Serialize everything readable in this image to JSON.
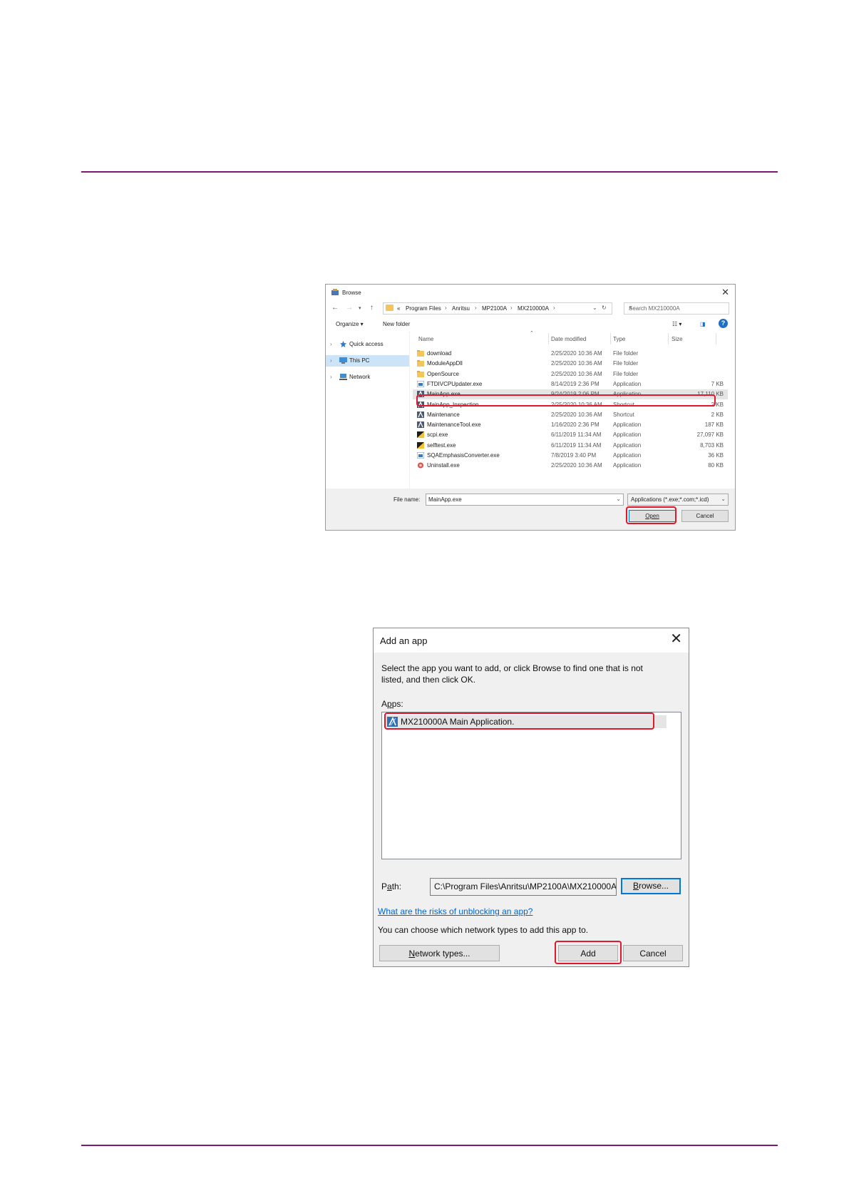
{
  "browse_dialog": {
    "title": "Browse",
    "close_glyph": "✕",
    "address_crumbs": [
      "«",
      "Program Files",
      "Anritsu",
      "MP2100A",
      "MX210000A"
    ],
    "search_placeholder": "Search MX210000A",
    "organize_label": "Organize ▾",
    "new_folder_label": "New folder",
    "help_glyph": "?",
    "nav_items": [
      {
        "label": "Quick access",
        "icon": "star-icon"
      },
      {
        "label": "This PC",
        "icon": "computer-icon",
        "selected": true
      },
      {
        "label": "Network",
        "icon": "network-icon"
      }
    ],
    "columns": [
      "Name",
      "Date modified",
      "Type",
      "Size"
    ],
    "files": [
      {
        "name": "download",
        "date": "2/25/2020 10:36 AM",
        "type": "File folder",
        "size": "",
        "icon": "folder-icon"
      },
      {
        "name": "ModuleAppDll",
        "date": "2/25/2020 10:36 AM",
        "type": "File folder",
        "size": "",
        "icon": "folder-icon"
      },
      {
        "name": "OpenSource",
        "date": "2/25/2020 10:36 AM",
        "type": "File folder",
        "size": "",
        "icon": "folder-icon"
      },
      {
        "name": "FTDIVCPUpdater.exe",
        "date": "8/14/2019 2:36 PM",
        "type": "Application",
        "size": "7 KB",
        "icon": "exe-icon"
      },
      {
        "name": "MainApp.exe",
        "date": "9/24/2019 2:06 PM",
        "type": "Application",
        "size": "17,110 KB",
        "icon": "anritsu-app-icon",
        "selected": true
      },
      {
        "name": "MainApp_Inspection",
        "date": "2/25/2020 10:36 AM",
        "type": "Shortcut",
        "size": "2 KB",
        "icon": "anritsu-app-icon"
      },
      {
        "name": "Maintenance",
        "date": "2/25/2020 10:36 AM",
        "type": "Shortcut",
        "size": "2 KB",
        "icon": "anritsu-app-icon"
      },
      {
        "name": "MaintenanceTool.exe",
        "date": "1/16/2020 2:36 PM",
        "type": "Application",
        "size": "187 KB",
        "icon": "anritsu-app-icon"
      },
      {
        "name": "scpi.exe",
        "date": "6/11/2019 11:34 AM",
        "type": "Application",
        "size": "27,097 KB",
        "icon": "scpi-icon"
      },
      {
        "name": "selftest.exe",
        "date": "6/11/2019 11:34 AM",
        "type": "Application",
        "size": "8,703 KB",
        "icon": "scpi-icon"
      },
      {
        "name": "SQAEmphasisConverter.exe",
        "date": "7/8/2019 3:40 PM",
        "type": "Application",
        "size": "36 KB",
        "icon": "exe-icon"
      },
      {
        "name": "Uninstall.exe",
        "date": "2/25/2020 10:36 AM",
        "type": "Application",
        "size": "80 KB",
        "icon": "uninstall-icon"
      }
    ],
    "file_name_label": "File name:",
    "file_name_value": "MainApp.exe",
    "file_type_value": "Applications (*.exe;*.com;*.icd)",
    "open_label": "Open",
    "cancel_label": "Cancel"
  },
  "add_app_dialog": {
    "title": "Add an app",
    "close_glyph": "✕",
    "description": "Select the app you want to add, or click Browse to find one that is not listed, and then click OK.",
    "apps_label": "Apps:",
    "apps": [
      "MX210000A Main Application."
    ],
    "path_label": "Path:",
    "path_value": "C:\\Program Files\\Anritsu\\MP2100A\\MX210000A\\",
    "browse_label": "Browse...",
    "risks_link": "What are the risks of unblocking an app?",
    "network_note": "You can choose which network types to add this app to.",
    "network_types_label": "Network types...",
    "add_label": "Add",
    "cancel_label": "Cancel"
  },
  "colors": {
    "rule": "#7b1a6e",
    "highlight": "#e0182b",
    "accent": "#0078d7"
  }
}
